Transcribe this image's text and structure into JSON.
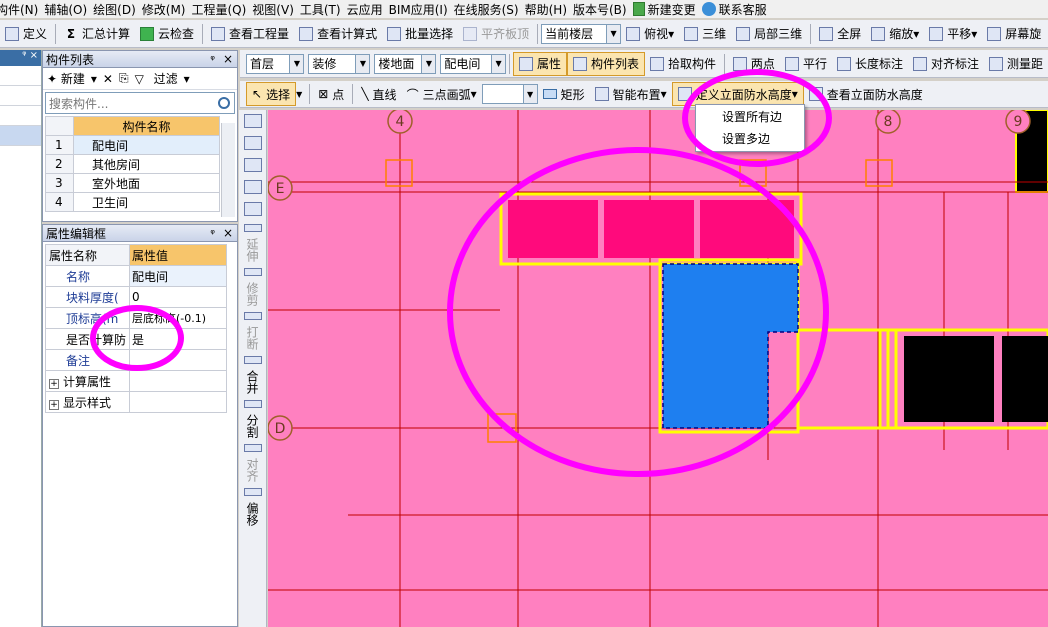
{
  "menu": {
    "items": [
      "构件(N)",
      "辅轴(O)",
      "绘图(D)",
      "修改(M)",
      "工程量(Q)",
      "视图(V)",
      "工具(T)",
      "云应用",
      "BIM应用(I)",
      "在线服务(S)",
      "帮助(H)",
      "版本号(B)"
    ],
    "new_change": "新建变更",
    "support": "联系客服"
  },
  "toolbar1": {
    "define": "定义",
    "summary": "汇总计算",
    "cloud_check": "云检查",
    "view_quantity": "查看工程量",
    "view_formula": "查看计算式",
    "batch_select": "批量选择",
    "flush_board": "平齐板顶",
    "floor_scope": "当前楼层",
    "top_view": "俯视",
    "three_d": "三维",
    "local_3d": "局部三维",
    "full_screen": "全屏",
    "zoom": "缩放",
    "pan": "平移",
    "screen_rotate": "屏幕旋"
  },
  "left_panel": {
    "title": "构件列表",
    "pin": "ᵠ",
    "close": "×",
    "new": "新建",
    "filter": "过滤",
    "search_placeholder": "搜索构件...",
    "column_header": "构件名称",
    "rows": [
      {
        "idx": "1",
        "name": "配电间"
      },
      {
        "idx": "2",
        "name": "其他房间"
      },
      {
        "idx": "3",
        "name": "室外地面"
      },
      {
        "idx": "4",
        "name": "卫生间"
      }
    ]
  },
  "prop_panel": {
    "title": "属性编辑框",
    "pin": "ᵠ",
    "close": "×",
    "col_name": "属性名称",
    "col_value": "属性值",
    "rows": [
      {
        "k": "名称",
        "v": "配电间"
      },
      {
        "k": "块料厚度(",
        "v": "0"
      },
      {
        "k": "顶标高(m",
        "v": "层底标高(-0.1)"
      },
      {
        "k": "是否计算防",
        "v": "是"
      },
      {
        "k": "备注",
        "v": ""
      }
    ],
    "group1": "计算属性",
    "group2": "显示样式"
  },
  "toolbar2": {
    "floor": "首层",
    "category": "装修",
    "type": "楼地面",
    "component": "配电间",
    "attributes": "属性",
    "component_list": "构件列表",
    "pick_component": "拾取构件",
    "two_points": "两点",
    "parallel": "平行",
    "length_dim": "长度标注",
    "aligned_dim": "对齐标注",
    "measure": "测量距"
  },
  "toolbar3": {
    "select": "选择",
    "point": "点",
    "line": "直线",
    "arc3": "三点画弧",
    "rect": "矩形",
    "smart_place": "智能布置",
    "define_waterproof": "定义立面防水高度",
    "view_waterproof": "查看立面防水高度"
  },
  "vtool": {
    "extend": "延伸",
    "trim": "修剪",
    "break": "打断",
    "merge": "合并",
    "split": "分割",
    "align": "对齐",
    "offset": "偏移"
  },
  "dropdown": {
    "set_all": "设置所有边",
    "set_multi": "设置多边"
  },
  "axes": {
    "top": [
      "4",
      "8",
      "9"
    ],
    "left": [
      "E",
      "D"
    ]
  },
  "colors": {
    "canvas_pink": "#ff80c0",
    "room_magenta": "#ff0a7c",
    "room_blue": "#1e7ff0",
    "wall_yellow": "#ffff00",
    "grid_red": "#c00000",
    "annotation": "#ff00ff"
  }
}
